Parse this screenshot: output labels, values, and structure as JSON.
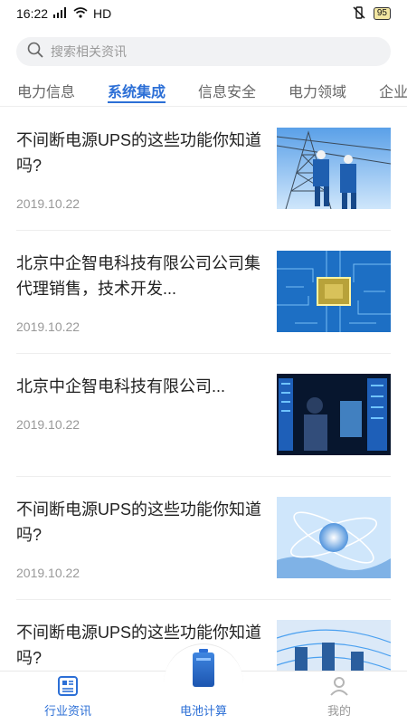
{
  "status_bar": {
    "time": "16:22",
    "network": "HD",
    "battery": "95"
  },
  "search": {
    "placeholder": "搜索相关资讯"
  },
  "tabs": [
    {
      "label": "电力信息",
      "active": false
    },
    {
      "label": "系统集成",
      "active": true
    },
    {
      "label": "信息安全",
      "active": false
    },
    {
      "label": "电力领域",
      "active": false
    },
    {
      "label": "企业",
      "active": false
    }
  ],
  "news": [
    {
      "title": "不间断电源UPS的这些功能你知道吗?",
      "date": "2019.10.22",
      "image": "power-line-workers"
    },
    {
      "title": "北京中企智电科技有限公司公司集代理销售，技术开发...",
      "date": "2019.10.22",
      "image": "circuit-chip"
    },
    {
      "title": "北京中企智电科技有限公司...",
      "date": "2019.10.22",
      "image": "server-room-engineer"
    },
    {
      "title": "不间断电源UPS的这些功能你知道吗?",
      "date": "2019.10.22",
      "image": "globe-network"
    },
    {
      "title": "不间断电源UPS的这些功能你知道吗?",
      "date": "",
      "image": "data-servers"
    }
  ],
  "bottom_nav": {
    "left": {
      "label": "行业资讯",
      "icon": "news-icon"
    },
    "center": {
      "label": "电池计算",
      "icon": "battery-icon"
    },
    "right": {
      "label": "我的",
      "icon": "profile-icon"
    }
  },
  "colors": {
    "accent": "#2c6fd6",
    "text": "#222222",
    "muted": "#999999"
  }
}
